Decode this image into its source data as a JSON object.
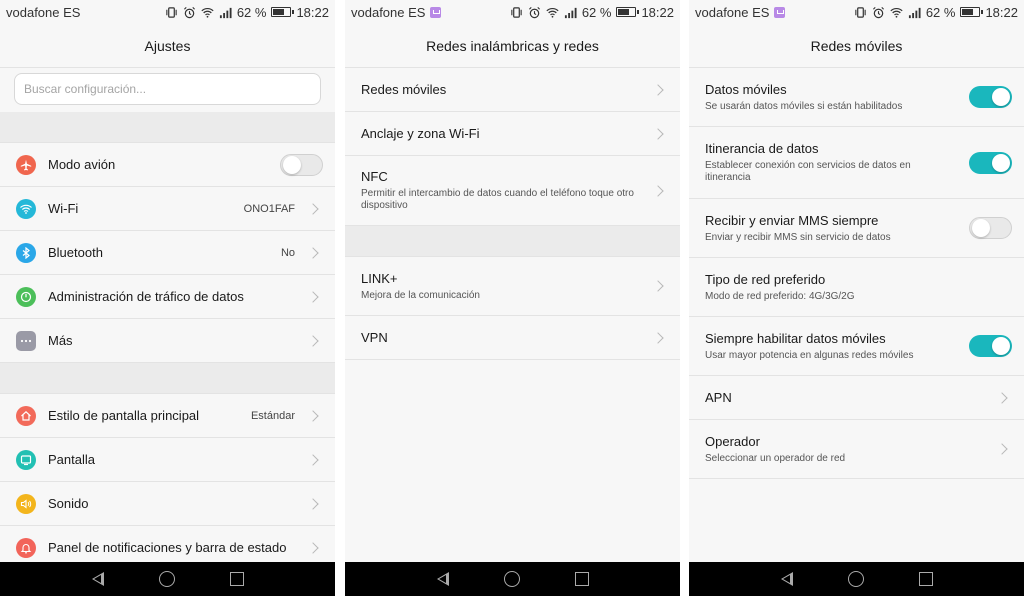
{
  "status": {
    "carrier": "vodafone ES",
    "battery_percent": "62 %",
    "time": "18:22"
  },
  "panels": [
    {
      "title": "Ajustes",
      "search_placeholder": "Buscar configuración...",
      "group1": [
        {
          "label": "Modo avión",
          "icon": "airplane-icon",
          "color": "#f0664e",
          "toggle": "off"
        },
        {
          "label": "Wi-Fi",
          "icon": "wifi-icon",
          "color": "#24b8d8",
          "value": "ONO1FAF"
        },
        {
          "label": "Bluetooth",
          "icon": "bluetooth-icon",
          "color": "#2aa7e8",
          "value": "No"
        },
        {
          "label": "Administración de tráfico de datos",
          "icon": "data-usage-icon",
          "color": "#4cbf5a"
        },
        {
          "label": "Más",
          "icon": "more-icon",
          "color": "#9a9aa6"
        }
      ],
      "group2": [
        {
          "label": "Estilo de pantalla principal",
          "icon": "home-icon",
          "color": "#f26a5a",
          "value": "Estándar"
        },
        {
          "label": "Pantalla",
          "icon": "display-icon",
          "color": "#22c0b3"
        },
        {
          "label": "Sonido",
          "icon": "sound-icon",
          "color": "#f3b51c"
        },
        {
          "label": "Panel de notificaciones y barra de estado",
          "icon": "notification-icon",
          "color": "#f2645a"
        }
      ]
    },
    {
      "title": "Redes inalámbricas y redes",
      "group1": [
        {
          "label": "Redes móviles"
        },
        {
          "label": "Anclaje y zona Wi-Fi"
        },
        {
          "label": "NFC",
          "sub": "Permitir el intercambio de datos cuando el teléfono toque otro dispositivo"
        }
      ],
      "group2": [
        {
          "label": "LINK+",
          "sub": "Mejora de la comunicación"
        },
        {
          "label": "VPN"
        }
      ]
    },
    {
      "title": "Redes móviles",
      "items": [
        {
          "label": "Datos móviles",
          "sub": "Se usarán datos móviles si están habilitados",
          "toggle": "on"
        },
        {
          "label": "Itinerancia de datos",
          "sub": "Establecer conexión con servicios de datos en itinerancia",
          "toggle": "on"
        },
        {
          "label": "Recibir y enviar MMS siempre",
          "sub": "Enviar y recibir MMS sin servicio de datos",
          "toggle": "off"
        },
        {
          "label": "Tipo de red preferido",
          "sub": "Modo de red preferido: 4G/3G/2G"
        },
        {
          "label": "Siempre habilitar datos móviles",
          "sub": "Usar mayor potencia en algunas redes móviles",
          "toggle": "on"
        },
        {
          "label": "APN",
          "chevron": true
        },
        {
          "label": "Operador",
          "sub": "Seleccionar un operador de red",
          "chevron": true
        }
      ]
    }
  ]
}
